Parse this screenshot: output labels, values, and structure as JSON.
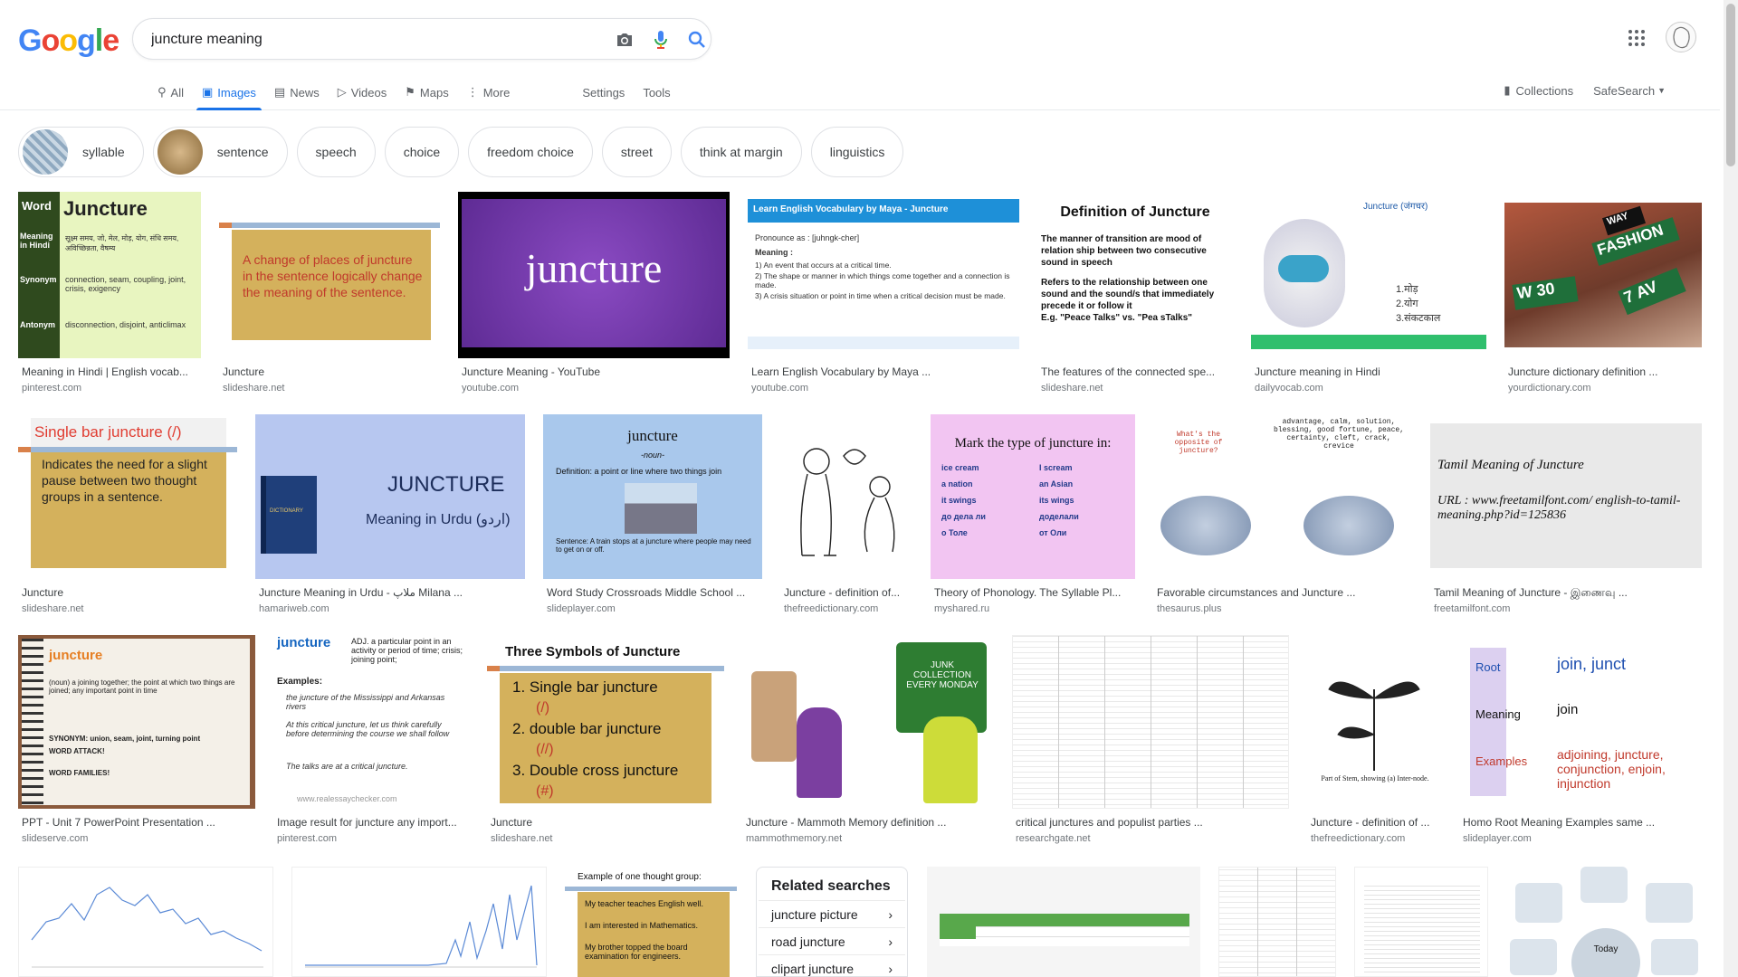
{
  "logo": "Google",
  "search": {
    "query": "juncture meaning"
  },
  "tabs": [
    {
      "label": "All",
      "icon": "search-icon"
    },
    {
      "label": "Images",
      "icon": "image-icon"
    },
    {
      "label": "News",
      "icon": "news-icon"
    },
    {
      "label": "Videos",
      "icon": "video-icon"
    },
    {
      "label": "Maps",
      "icon": "map-icon"
    },
    {
      "label": "More",
      "icon": "more-vert-icon"
    }
  ],
  "settings_tools": {
    "settings": "Settings",
    "tools": "Tools"
  },
  "right_links": {
    "collections": "Collections",
    "safesearch": "SafeSearch"
  },
  "chips": [
    "syllable",
    "sentence",
    "speech",
    "choice",
    "freedom choice",
    "street",
    "think at margin",
    "linguistics"
  ],
  "results": [
    {
      "title": "Meaning in Hindi | English vocab...",
      "source": "pinterest.com",
      "thumb": {
        "word": "Word",
        "head": "Juncture",
        "r1": "Meaning in Hindi",
        "r1v": "सूक्ष्म समय, जो, मेल, मोड़, योग, संधि समय, अविच्छिन्नता, वैषम्य",
        "r2": "Synonym",
        "r2v": "connection, seam, coupling, joint, crisis, exigency",
        "r3": "Antonym",
        "r3v": "disconnection, disjoint, anticlimax"
      }
    },
    {
      "title": "Juncture",
      "source": "slideshare.net",
      "thumb": {
        "text": "A change of places of juncture in the sentence logically change the meaning  of the sentence."
      }
    },
    {
      "title": "Juncture Meaning - YouTube",
      "source": "youtube.com",
      "thumb": {
        "text": "juncture"
      }
    },
    {
      "title": "Learn English Vocabulary by Maya ...",
      "source": "youtube.com",
      "thumb": {
        "head": "Learn English Vocabulary by Maya - Juncture",
        "pron": "Pronounce as : [juhngk-cher]",
        "mh": "Meaning :",
        "m1": "1) An event that occurs at a critical time.",
        "m2": "2) The shape or manner in which things come together and a connection is made.",
        "m3": "3) A crisis situation or point in time when a critical decision must be made."
      }
    },
    {
      "title": "The features of the connected spe...",
      "source": "slideshare.net",
      "thumb": {
        "head": "Definition of Juncture",
        "b1": "The manner of transition are mood of relation ship between two consecutive sound  in speech",
        "b2": "Refers to the relationship between one sound and the sound/s that immediately precede it or follow it",
        "b3": "E.g. \"Peace Talks\" vs. \"Pea sTalks\""
      }
    },
    {
      "title": "Juncture meaning in Hindi",
      "source": "dailyvocab.com",
      "thumb": {
        "head": "Juncture (जंगचर)",
        "l1": "1.मोड़",
        "l2": "2.योग",
        "l3": "3.संकटकाल"
      }
    },
    {
      "title": "Juncture dictionary definition ...",
      "source": "yourdictionary.com",
      "thumb": {
        "s1": "FASHION",
        "s2": "W 30",
        "s3": "7 AV",
        "s4": "WAY"
      }
    },
    {
      "title": "Juncture",
      "source": "slideshare.net",
      "thumb": {
        "head": "Single bar juncture   (/)",
        "text": "Indicates the need for a slight pause between two thought groups in a sentence."
      }
    },
    {
      "title": "Juncture Meaning in Urdu - ملاپ Milana ...",
      "source": "hamariweb.com",
      "thumb": {
        "head": "JUNCTURE",
        "sub": "Meaning in Urdu (اردو)",
        "book": "DICTIONARY"
      }
    },
    {
      "title": "Word Study Crossroads Middle School ...",
      "source": "slideplayer.com",
      "thumb": {
        "head": "juncture",
        "pos": "-noun-",
        "def": "Definition: a point or line where two things join",
        "sen": "Sentence: A train stops at a juncture where people may need to get on or off."
      }
    },
    {
      "title": "Juncture - definition of...",
      "source": "thefreedictionary.com",
      "thumb": {}
    },
    {
      "title": "Theory of Phonology. The Syllable Pl...",
      "source": "myshared.ru",
      "thumb": {
        "head": "Mark the type of juncture in:",
        "c1": [
          "ice cream",
          "a nation",
          "it swings",
          "до дела ли",
          "о Толе"
        ],
        "c2": [
          "I scream",
          "an Asian",
          "its wings",
          "доделали",
          "от Оли"
        ]
      }
    },
    {
      "title": "Favorable circumstances and Juncture ...",
      "source": "thesaurus.plus",
      "thumb": {
        "q": "What's the opposite of juncture?",
        "a": "advantage, calm, solution, blessing, good fortune, peace, certainty, cleft, crack, crevice"
      }
    },
    {
      "title": "Tamil Meaning of Juncture - இணைவு ...",
      "source": "freetamilfont.com",
      "thumb": {
        "head": "Tamil Meaning of Juncture",
        "url": "URL : www.freetamilfont.com/ english-to-tamil-meaning.php?id=125836"
      }
    },
    {
      "title": "PPT - Unit 7 PowerPoint Presentation ...",
      "source": "slideserve.com",
      "thumb": {
        "head": "juncture",
        "l1": "(noun) a joining together; the point at which two things are joined; any important point in time",
        "l2": "SYNONYM: union, seam, joint, turning point",
        "l3": "WORD ATTACK!",
        "l4": "WORD FAMILIES!"
      }
    },
    {
      "title": "Image result for juncture any import...",
      "source": "pinterest.com",
      "thumb": {
        "head": "juncture",
        "adj": "ADJ. a particular point in an activity or period of time; crisis; joining point;",
        "ex": "Examples:",
        "e1": "the juncture of the Mississippi and Arkansas rivers",
        "e2": "At this critical juncture, let us think carefully before determining the course we shall follow",
        "e3": "The talks are at a critical juncture.",
        "foot": "www.realessaychecker.com"
      }
    },
    {
      "title": "Juncture",
      "source": "slideshare.net",
      "thumb": {
        "head": "Three Symbols of Juncture",
        "i1": "1. Single bar juncture",
        "s1": "(/)",
        "i2": "2. double bar juncture",
        "s2": "(//)",
        "i3": "3. Double cross juncture",
        "s3": "(#)"
      }
    },
    {
      "title": "Juncture - Mammoth Memory definition ...",
      "source": "mammothmemory.net",
      "thumb": {
        "truck": "JUNK COLLECTION EVERY MONDAY"
      }
    },
    {
      "title": "critical junctures and populist parties ...",
      "source": "researchgate.net",
      "thumb": {}
    },
    {
      "title": "Juncture - definition of ...",
      "source": "thefreedictionary.com",
      "thumb": {
        "cap": "Part of Stem, showing (a) Inter-node."
      }
    },
    {
      "title": "Homo Root Meaning Examples same ...",
      "source": "slideplayer.com",
      "thumb": {
        "r1": "Root",
        "r1v": "join, junct",
        "r2": "Meaning",
        "r2v": "join",
        "r3": "Examples",
        "r3v": "adjoining, juncture, conjunction, enjoin, injunction"
      }
    }
  ],
  "row4": {
    "example": {
      "head": "Example of one thought group:",
      "l1": "My teacher teaches English well.",
      "l2": "I am interested in Mathematics.",
      "l3": "My brother topped the board examination for engineers."
    },
    "today": "Today"
  },
  "related": {
    "title": "Related searches",
    "items": [
      "juncture picture",
      "road juncture",
      "clipart juncture"
    ]
  }
}
